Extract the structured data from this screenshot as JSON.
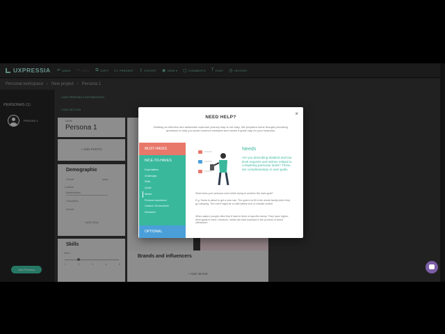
{
  "toolbar": {
    "logo": "UXPRESSIA",
    "items": [
      {
        "icon": "undo-icon",
        "glyph": "↶",
        "label": "UNDO"
      },
      {
        "icon": "redo-icon",
        "glyph": "↷",
        "label": "REDO"
      },
      {
        "icon": "copy-icon",
        "glyph": "⧉",
        "label": "COPY"
      },
      {
        "icon": "present-icon",
        "glyph": "▭",
        "label": "PRESENT"
      },
      {
        "icon": "export-icon",
        "glyph": "⇪",
        "label": "EXPORT"
      },
      {
        "icon": "view-icon",
        "glyph": "◉",
        "label": "VIEW ▾"
      },
      {
        "icon": "comments-icon",
        "glyph": "▢",
        "label": "COMMENTS"
      },
      {
        "icon": "font-icon",
        "glyph": "T",
        "label": "FONT"
      },
      {
        "icon": "history-icon",
        "glyph": "◷",
        "label": "HISTORY"
      }
    ]
  },
  "breadcrumb": [
    "Personal workspace",
    "New project",
    "Persona 1"
  ],
  "sidebar": {
    "title": "PERSONAS (1)",
    "persona_label": "Persona 1",
    "add_button": "Add Persona"
  },
  "main": {
    "link_add_section": "+ ADD PERSONA CUSTOMIZATION",
    "link_add_section2": "+ ADD SECTION",
    "name_label": "NAME",
    "persona_name": "Persona 1",
    "add_photo": "+ ADD PHOTO",
    "demographic_title": "Demographic",
    "age_label": "years",
    "gender_label": "Gender",
    "location_label": "Location",
    "marital_status": "Marital status",
    "occupation": "Occupation",
    "income": "Income",
    "add_field": "+ ADD FIELD",
    "skills_title": "Skills",
    "skill1": "Skill 1",
    "skill_scale": [
      "1",
      "2",
      "3",
      "4",
      "5"
    ],
    "brands_title": "Brands and influencers",
    "add_image": "+ ADD IMAGE"
  },
  "modal": {
    "title": "NEED HELP?",
    "close": "×",
    "desc": "Building an effective and actionable customer journey map is not easy. We prepared some thought-provoking questions to help you avoid common mistakes and create a great map for your business.",
    "cat_must": "MUST-HAVES",
    "cat_nice": "NICE-TO-HAVES",
    "nice_items": [
      "Expectations",
      "Challenges",
      "Skills",
      "Quote",
      "Needs",
      "Previous experience",
      "Context / Environment",
      "Scenarios"
    ],
    "cat_optional": "OPTIONAL",
    "needs_title": "Needs",
    "needs_desc": "Are you describing detailed and low-level requests and wishes related to completing particular tasks? These are complementary to user goals.",
    "p1": "What does your persona need while trying to achieve the main goal?",
    "p2": "E.g. Sonia is about to get a new van. The goal is to fit in the whole family when they go camping. The need might be a child safety lock or climate control.",
    "p3": "When asked, people often find it hard to think of specific needs. They have higher-level goals in mind. However, needs are best exposed in the process of direct interaction."
  },
  "colors": {
    "must": "#e8786a",
    "nice": "#39b89c",
    "optional": "#4a9fd9",
    "accent": "#6fc2ad"
  }
}
